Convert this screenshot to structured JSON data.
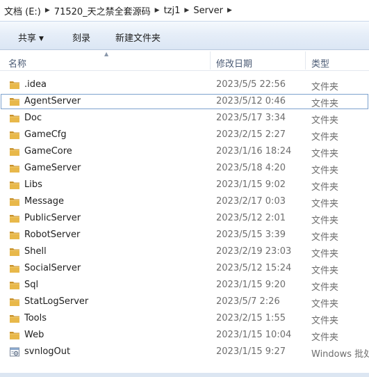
{
  "breadcrumb": [
    {
      "label": "文档 (E:)"
    },
    {
      "label": "71520_天之禁全套源码"
    },
    {
      "label": "tzj1"
    },
    {
      "label": "Server"
    }
  ],
  "toolbar": {
    "share_label": "共享",
    "burn_label": "刻录",
    "new_folder_label": "新建文件夹"
  },
  "columns": {
    "name": "名称",
    "date_modified": "修改日期",
    "type": "类型"
  },
  "files": [
    {
      "name": ".idea",
      "date": "2023/5/5 22:56",
      "type": "文件夹",
      "icon": "folder-icon"
    },
    {
      "name": "AgentServer",
      "date": "2023/5/12 0:46",
      "type": "文件夹",
      "icon": "folder-icon"
    },
    {
      "name": "Doc",
      "date": "2023/5/17 3:34",
      "type": "文件夹",
      "icon": "folder-icon"
    },
    {
      "name": "GameCfg",
      "date": "2023/2/15 2:27",
      "type": "文件夹",
      "icon": "folder-icon"
    },
    {
      "name": "GameCore",
      "date": "2023/1/16 18:24",
      "type": "文件夹",
      "icon": "folder-icon"
    },
    {
      "name": "GameServer",
      "date": "2023/5/18 4:20",
      "type": "文件夹",
      "icon": "folder-icon"
    },
    {
      "name": "Libs",
      "date": "2023/1/15 9:02",
      "type": "文件夹",
      "icon": "folder-icon"
    },
    {
      "name": "Message",
      "date": "2023/2/17 0:03",
      "type": "文件夹",
      "icon": "folder-icon"
    },
    {
      "name": "PublicServer",
      "date": "2023/5/12 2:01",
      "type": "文件夹",
      "icon": "folder-icon"
    },
    {
      "name": "RobotServer",
      "date": "2023/5/15 3:39",
      "type": "文件夹",
      "icon": "folder-icon"
    },
    {
      "name": "Shell",
      "date": "2023/2/19 23:03",
      "type": "文件夹",
      "icon": "folder-icon"
    },
    {
      "name": "SocialServer",
      "date": "2023/5/12 15:24",
      "type": "文件夹",
      "icon": "folder-icon"
    },
    {
      "name": "Sql",
      "date": "2023/1/15 9:20",
      "type": "文件夹",
      "icon": "folder-icon"
    },
    {
      "name": "StatLogServer",
      "date": "2023/5/7 2:26",
      "type": "文件夹",
      "icon": "folder-icon"
    },
    {
      "name": "Tools",
      "date": "2023/2/15 1:55",
      "type": "文件夹",
      "icon": "folder-icon"
    },
    {
      "name": "Web",
      "date": "2023/1/15 10:04",
      "type": "文件夹",
      "icon": "folder-icon"
    },
    {
      "name": "svnlogOut",
      "date": "2023/1/15 9:27",
      "type": "Windows 批处",
      "icon": "batch-file-icon"
    }
  ],
  "colors": {
    "folder": "#e8b84a",
    "folder_dark": "#c9922a",
    "toolbar": "#dbe6f4",
    "focus_outline": "#7da2ce"
  }
}
